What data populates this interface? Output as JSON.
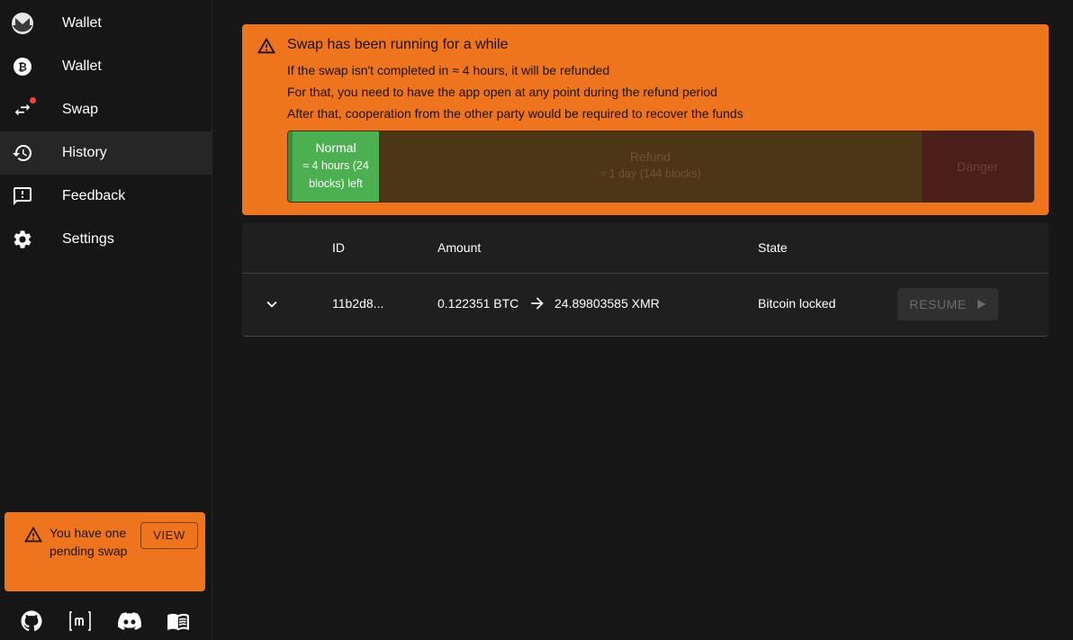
{
  "sidebar": {
    "items": [
      {
        "label": "Wallet",
        "icon": "monero-icon"
      },
      {
        "label": "Wallet",
        "icon": "bitcoin-icon"
      },
      {
        "label": "Swap",
        "icon": "swap-arrows-icon"
      },
      {
        "label": "History",
        "icon": "history-icon"
      },
      {
        "label": "Feedback",
        "icon": "feedback-icon"
      },
      {
        "label": "Settings",
        "icon": "gear-icon"
      }
    ],
    "active_index": 3,
    "pending_alert": {
      "text": "You have one pending swap",
      "button_label": "VIEW"
    },
    "footer_icons": [
      "github-icon",
      "matrix-icon",
      "discord-icon",
      "docs-book-icon"
    ]
  },
  "banner": {
    "title": "Swap has been running for a while",
    "lines": [
      "If the swap isn't completed in ≈ 4 hours, it will be refunded",
      "For that, you need to have the app open at any point during the refund period",
      "After that, cooperation from the other party would be required to recover the funds"
    ],
    "timeline": {
      "normal": {
        "title": "Normal",
        "subtitle": "≈ 4 hours (24 blocks) left"
      },
      "refund": {
        "title": "Refund",
        "subtitle": "≈ 1 day (144 blocks)"
      },
      "danger": {
        "title": "Danger"
      }
    }
  },
  "table": {
    "headers": {
      "id": "ID",
      "amount": "Amount",
      "state": "State"
    },
    "rows": [
      {
        "id": "11b2d8...",
        "amount_from": "0.122351 BTC",
        "amount_to": "24.89803585 XMR",
        "state": "Bitcoin locked",
        "action_label": "RESUME"
      }
    ]
  },
  "colors": {
    "warning": "#ef741e",
    "normal": "#4caf50",
    "background": "#171717",
    "badge": "#f44336"
  }
}
